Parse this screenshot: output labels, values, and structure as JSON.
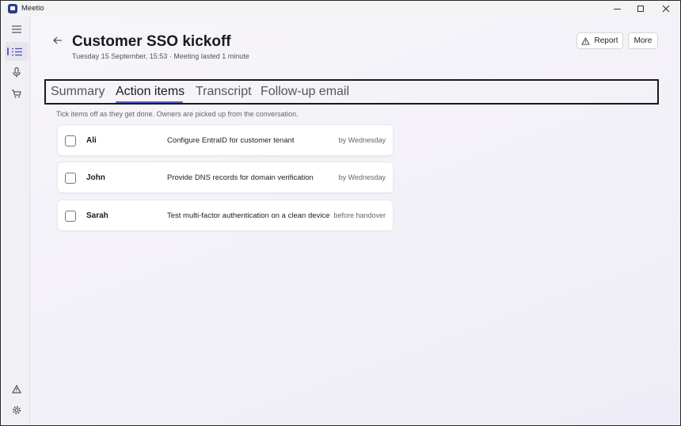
{
  "app": {
    "title": "Meetio"
  },
  "window_controls": {
    "minimize": "minimize-icon",
    "maximize": "maximize-icon",
    "close": "close-icon"
  },
  "sidebar": {
    "items": [
      {
        "icon": "hamburger-icon",
        "active": false
      },
      {
        "icon": "list-icon",
        "active": true
      },
      {
        "icon": "microphone-icon",
        "active": false
      },
      {
        "icon": "cart-icon",
        "active": false
      }
    ],
    "bottom_items": [
      {
        "icon": "warning-icon"
      },
      {
        "icon": "gear-icon"
      }
    ]
  },
  "header": {
    "title": "Customer SSO kickoff",
    "subtitle": "Tuesday 15 September, 15:53 · Meeting lasted 1 minute",
    "report_label": "Report",
    "more_label": "More"
  },
  "tabs": [
    {
      "label": "Summary",
      "active": false
    },
    {
      "label": "Action items",
      "active": true
    },
    {
      "label": "Transcript",
      "active": false
    },
    {
      "label": "Follow-up email",
      "active": false
    }
  ],
  "hint": "Tick items off as they get done. Owners are picked up from the conversation.",
  "action_items": [
    {
      "owner": "Ali",
      "task": "Configure EntraID for customer tenant",
      "due": "by Wednesday",
      "checked": false
    },
    {
      "owner": "John",
      "task": "Provide DNS records for domain verification",
      "due": "by Wednesday",
      "checked": false
    },
    {
      "owner": "Sarah",
      "task": "Test multi-factor authentication on a clean device",
      "due": "before handover",
      "checked": false
    }
  ],
  "colors": {
    "accent": "#5b5fc7",
    "background": "#f3f1f7"
  }
}
